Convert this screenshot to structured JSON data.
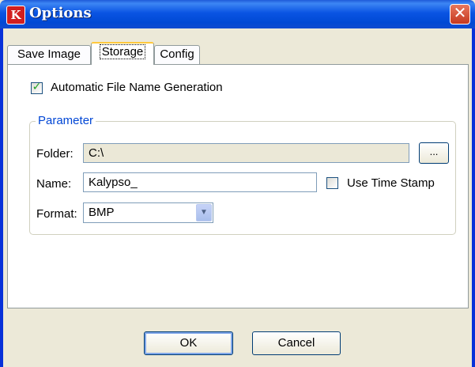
{
  "window": {
    "title": "Options",
    "app_icon_letter": "K",
    "close_glyph": "✕"
  },
  "tabs": [
    {
      "label": "Save Image",
      "active": false
    },
    {
      "label": "Storage",
      "active": true
    },
    {
      "label": "Config",
      "active": false
    }
  ],
  "storage": {
    "auto_filename": {
      "label": "Automatic File Name Generation",
      "checked": true
    },
    "parameter_group": {
      "title": "Parameter",
      "folder": {
        "label": "Folder:",
        "value": "C:\\",
        "browse_label": "...",
        "enabled": false
      },
      "name": {
        "label": "Name:",
        "value": "Kalypso_"
      },
      "timestamp": {
        "label": "Use Time Stamp",
        "checked": false
      },
      "format": {
        "label": "Format:",
        "value": "BMP"
      }
    }
  },
  "buttons": {
    "ok": "OK",
    "cancel": "Cancel"
  },
  "colors": {
    "titlebar": "#0054e3",
    "dialog_bg": "#ece9d8",
    "group_title": "#0046d5",
    "active_tab_highlight": "#ffc83c"
  },
  "icons": {
    "app": "kalypso-k-icon",
    "close": "close-icon",
    "checkmark": "checkmark-icon",
    "dropdown": "chevron-down-icon"
  }
}
